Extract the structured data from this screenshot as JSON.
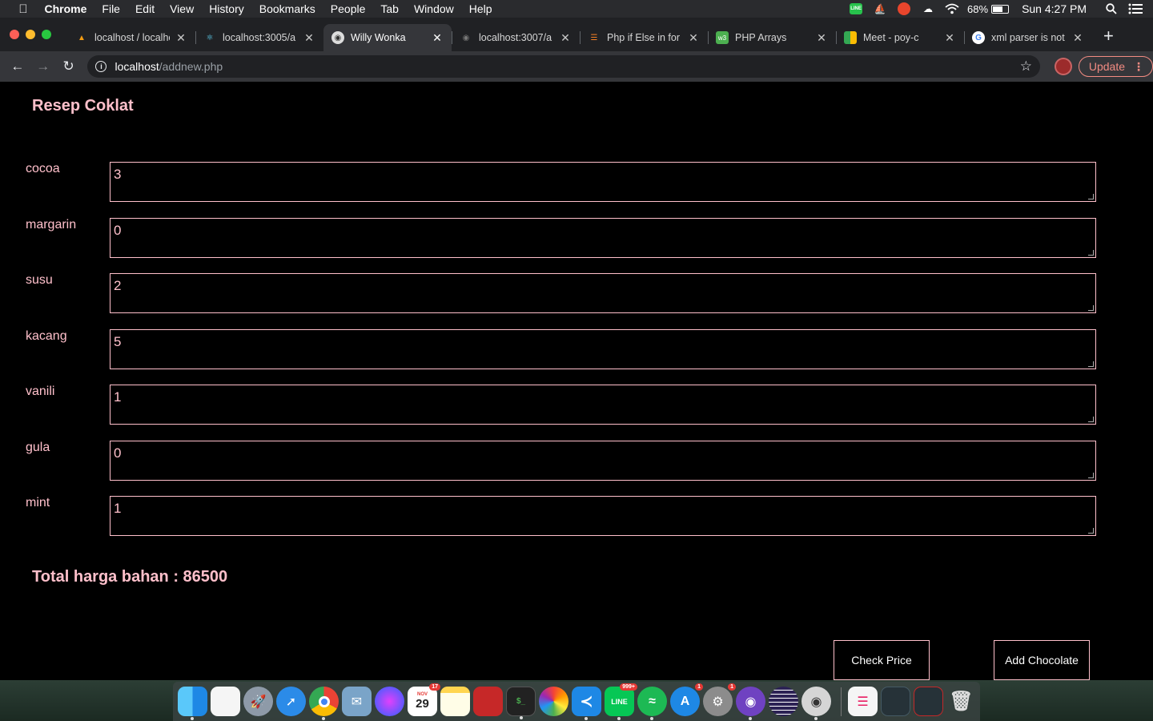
{
  "menubar": {
    "app_name": "Chrome",
    "items": [
      "File",
      "Edit",
      "View",
      "History",
      "Bookmarks",
      "People",
      "Tab",
      "Window",
      "Help"
    ],
    "battery": "68%",
    "clock": "Sun 4:27 PM",
    "tray_line_text": "LINE"
  },
  "tabs": [
    {
      "title": "localhost / localhost",
      "icon": "phpmyadmin-icon"
    },
    {
      "title": "localhost:3005/a",
      "icon": "react-icon"
    },
    {
      "title": "Willy Wonka",
      "icon": "willy-wonka-icon",
      "active": true
    },
    {
      "title": "localhost:3007/a",
      "icon": "globe-icon"
    },
    {
      "title": "Php if Else in for",
      "icon": "stackoverflow-icon"
    },
    {
      "title": "PHP Arrays",
      "icon": "w3schools-icon"
    },
    {
      "title": "Meet - poy-c",
      "icon": "meet-icon"
    },
    {
      "title": "xml parser is not",
      "icon": "google-icon"
    }
  ],
  "toolbar": {
    "url_host": "localhost",
    "url_path": "/addnew.php",
    "update_label": "Update"
  },
  "page": {
    "title": "Resep Coklat",
    "ingredients": [
      {
        "label": "cocoa",
        "value": "3"
      },
      {
        "label": "margarin",
        "value": "0"
      },
      {
        "label": "susu",
        "value": "2"
      },
      {
        "label": "kacang",
        "value": "5"
      },
      {
        "label": "vanili",
        "value": "1"
      },
      {
        "label": "gula",
        "value": "0"
      },
      {
        "label": "mint",
        "value": "1"
      }
    ],
    "total_label": "Total harga bahan : 86500",
    "check_price_label": "Check Price",
    "add_chocolate_label": "Add Chocolate"
  },
  "dock": {
    "calendar_month": "NOV",
    "calendar_day": "29",
    "calendar_badge": "17",
    "line_badge": "999+",
    "appstore_badge": "1",
    "prefs_badge": "1"
  },
  "colors": {
    "accent_pink": "#ffc0cb",
    "page_bg": "#000000",
    "update_red": "#f28b82"
  }
}
